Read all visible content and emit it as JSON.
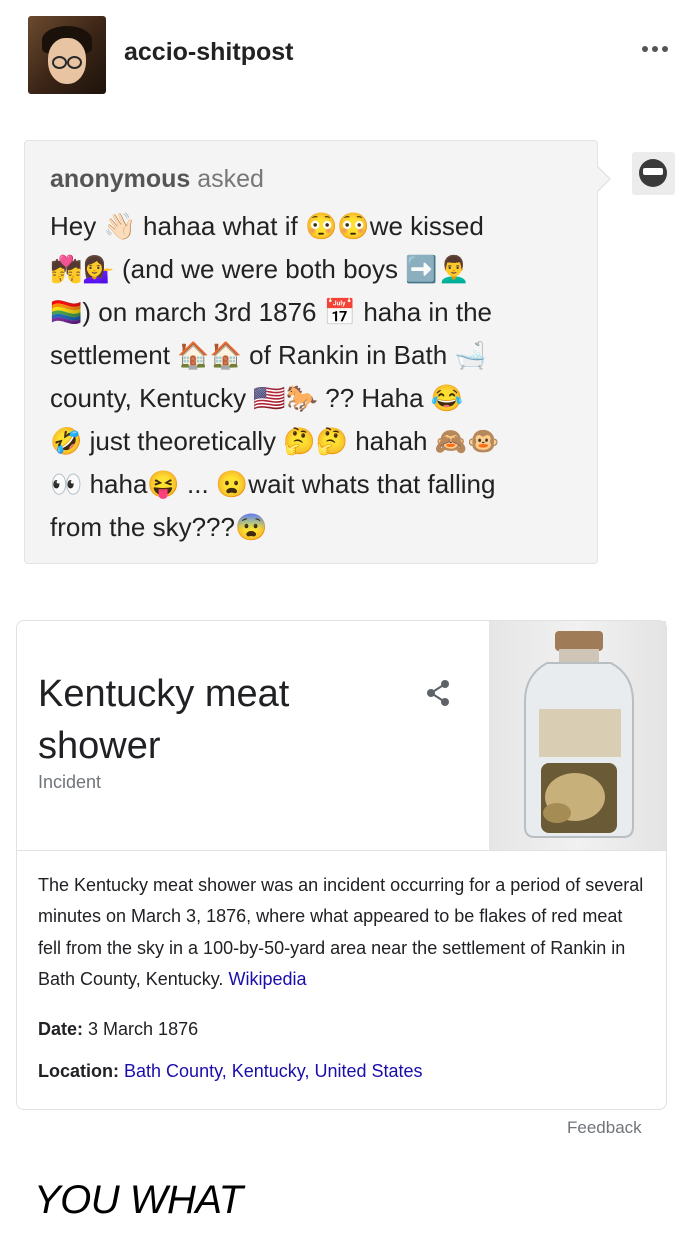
{
  "post": {
    "username": "accio-shitpost",
    "more_icon": "more-horizontal-icon"
  },
  "ask": {
    "asker_name": "anonymous",
    "asker_verb": "asked",
    "message": "Hey 👋🏻 hahaa what if 😳😳we kissed\n💏💁‍♀️ (and we were both boys ➡️👨‍🦱\n🏳️‍🌈) on march 3rd 1876 📅 haha in the\nsettlement 🏠🏠 of Rankin in Bath 🛁\ncounty, Kentucky 🇺🇸🐎 ?? Haha 😂\n🤣 just theoretically 🤔🤔 hahah 🙈🐵\n👀 haha😝 ... 😦wait whats that falling\nfrom the sky???😨",
    "anon_avatar_icon": "sunglasses-face-icon"
  },
  "card": {
    "title": "Kentucky meat shower",
    "subtitle": "Incident",
    "share_icon": "share-icon",
    "image": "jar-specimen-image",
    "description": "The Kentucky meat shower was an incident occurring for a period of several minutes on March 3, 1876, where what appeared to be flakes of red meat fell from the sky in a 100-by-50-yard area near the settlement of Rankin in Bath County, Kentucky.",
    "source_link": "Wikipedia",
    "facts": {
      "date_label": "Date:",
      "date_value": "3 March 1876",
      "location_label": "Location:",
      "location_value": "Bath County, Kentucky, United States"
    },
    "feedback_label": "Feedback"
  },
  "caption": "YOU WHAT",
  "colors": {
    "link": "#1a0dab",
    "ask_bg": "#f4f4f4",
    "muted": "#70757a"
  }
}
